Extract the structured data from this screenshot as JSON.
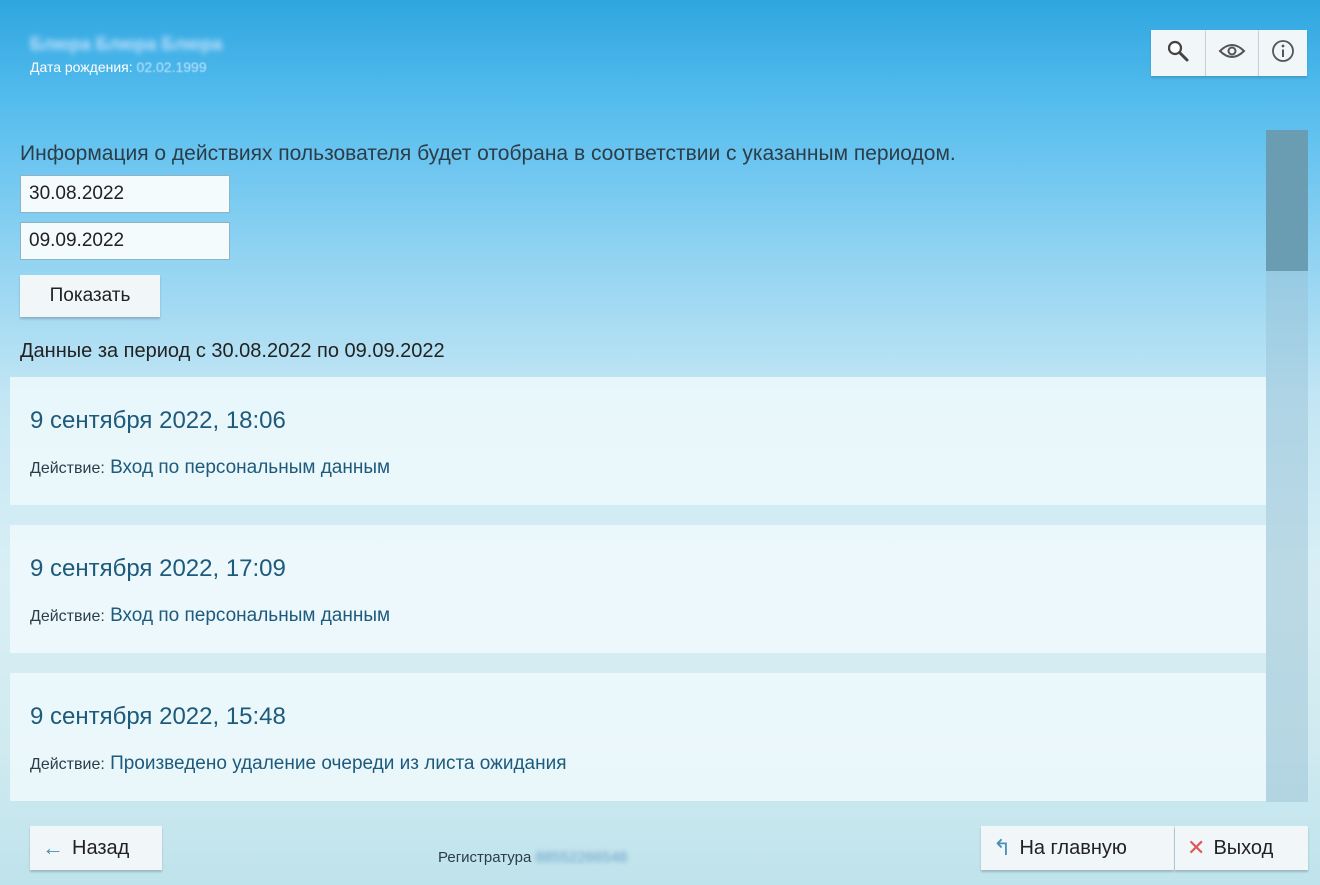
{
  "header": {
    "patient_name": "Блюра Блюра Блюра",
    "birth_label": "Дата рождения:",
    "birth_value": "02.02.1999",
    "tools": [
      {
        "icon": "search-icon"
      },
      {
        "icon": "eye-icon"
      },
      {
        "icon": "info-icon"
      }
    ]
  },
  "filter": {
    "info_text": "Информация о действиях пользователя будет отобрана в соответствии с указанным периодом.",
    "date_from": "30.08.2022",
    "date_to": "09.09.2022",
    "show_label": "Показать",
    "period_text": "Данные за период с 30.08.2022 по 09.09.2022"
  },
  "records": [
    {
      "date": "9 сентября 2022, 18:06",
      "action_label": "Действие:",
      "action_value": "Вход по персональным данным"
    },
    {
      "date": "9 сентября 2022, 17:09",
      "action_label": "Действие:",
      "action_value": "Вход по персональным данным"
    },
    {
      "date": "9 сентября 2022, 15:48",
      "action_label": "Действие:",
      "action_value": "Произведено удаление очереди из листа ожидания"
    }
  ],
  "footer": {
    "back_label": "Назад",
    "registry_label": "Регистратура",
    "registry_number": "88552266548",
    "home_label": "На главную",
    "exit_label": "Выход"
  },
  "colors": {
    "accent": "#1d5a7c",
    "exit_x": "#e05555",
    "arrow": "#4a8fb5"
  }
}
